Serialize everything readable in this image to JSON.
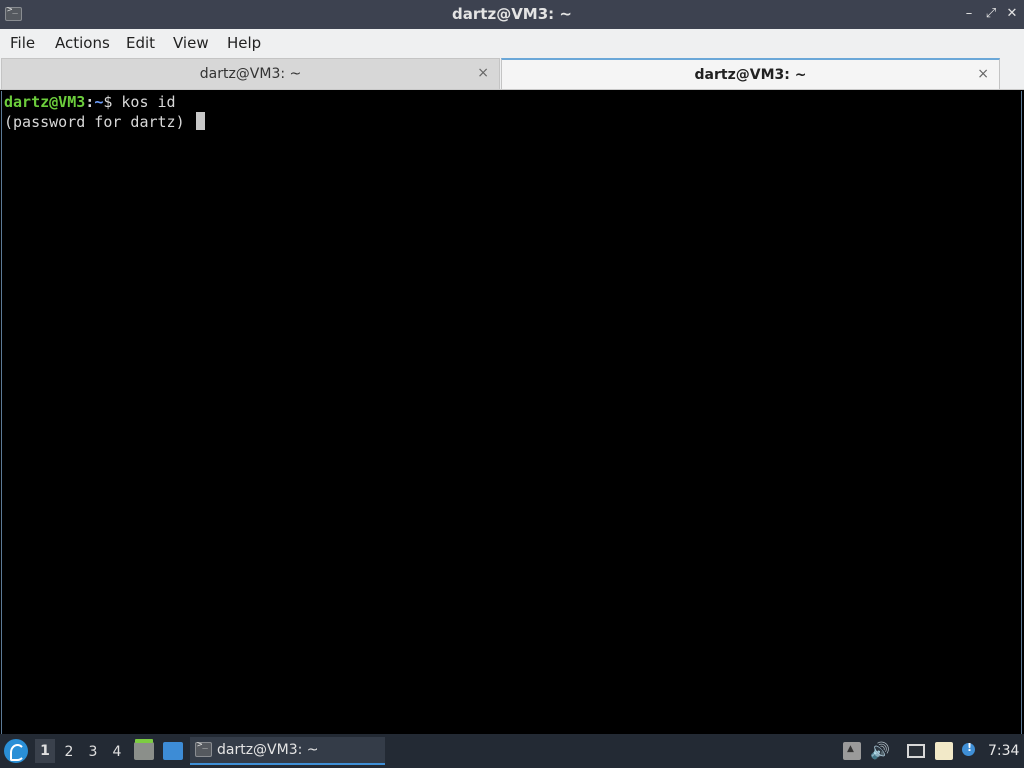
{
  "window": {
    "title": "dartz@VM3: ~",
    "icon": "terminal-icon",
    "controls": {
      "minimize": "–",
      "maximize": "⤢",
      "close": "✕"
    }
  },
  "menu": {
    "file": "File",
    "actions": "Actions",
    "edit": "Edit",
    "view": "View",
    "help": "Help"
  },
  "tabs": [
    {
      "label": "dartz@VM3: ~",
      "active": false,
      "close": "×"
    },
    {
      "label": "dartz@VM3: ~",
      "active": true,
      "close": "×"
    }
  ],
  "terminal": {
    "prompt_user": "dartz@VM3",
    "prompt_sep": ":",
    "prompt_path": "~",
    "prompt_symbol": "$ ",
    "command": "kos id",
    "output_line": "(password for dartz) "
  },
  "taskbar": {
    "start_icon": "start-menu-icon",
    "workspaces": [
      "1",
      "2",
      "3",
      "4"
    ],
    "current_workspace": "1",
    "quicklaunch": [
      "file-manager-icon",
      "show-desktop-icon"
    ],
    "task": {
      "label": "dartz@VM3: ~",
      "icon": "terminal-icon"
    },
    "tray": [
      "tray-expand-icon",
      "volume-icon",
      "network-icon",
      "clipboard-icon",
      "notification-icon"
    ],
    "volume_glyph": "🔊",
    "clock": "7:34"
  },
  "colors": {
    "titlebar": "#3d4250",
    "terminal_bg": "#000000",
    "prompt_user": "#6ccd3c",
    "prompt_path": "#6fa0ff",
    "taskbar": "#232a34",
    "active_tab_accent": "#6aa7d8"
  }
}
